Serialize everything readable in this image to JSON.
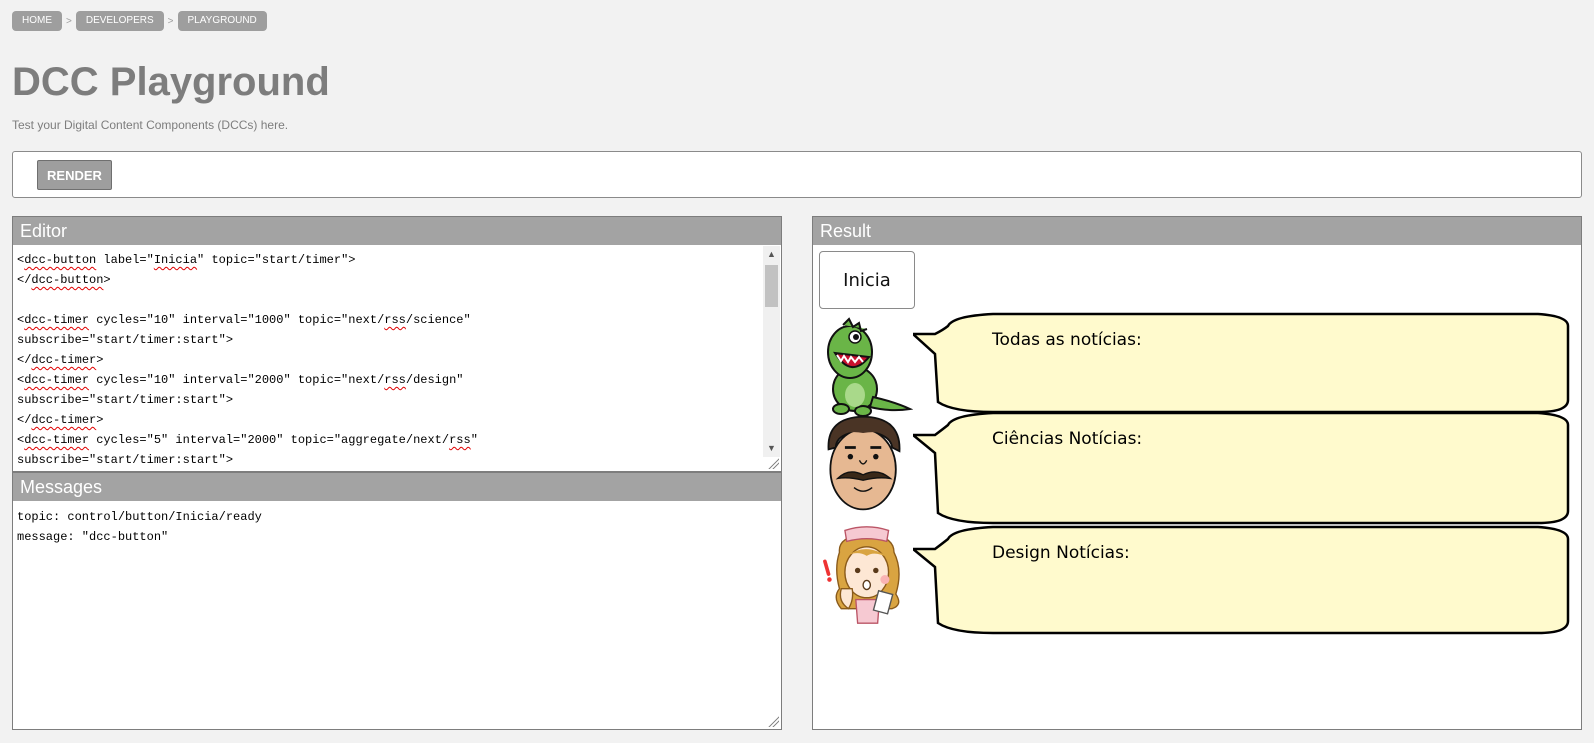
{
  "breadcrumb": [
    "HOME",
    "DEVELOPERS",
    "PLAYGROUND"
  ],
  "breadcrumb_separator": ">",
  "page": {
    "title": "DCC Playground",
    "subtitle": "Test your Digital Content Components (DCCs) here."
  },
  "toolbar": {
    "render_label": "RENDER"
  },
  "editor": {
    "title": "Editor",
    "lines": [
      "<dcc-button label=\"Inicia\" topic=\"start/timer\">",
      "</dcc-button>",
      "",
      "<dcc-timer cycles=\"10\" interval=\"1000\" topic=\"next/rss/science\"",
      "subscribe=\"start/timer:start\">",
      "</dcc-timer>",
      "<dcc-timer cycles=\"10\" interval=\"2000\" topic=\"next/rss/design\"",
      "subscribe=\"start/timer:start\">",
      "</dcc-timer>",
      "<dcc-timer cycles=\"5\" interval=\"2000\" topic=\"aggregate/next/rss\"",
      "subscribe=\"start/timer:start\">"
    ]
  },
  "messages": {
    "title": "Messages",
    "topic_line": "topic: control/button/Inicia/ready",
    "message_line": "message: \"dcc-button\""
  },
  "result": {
    "title": "Result",
    "button_label": "Inicia",
    "bubbles": [
      {
        "character": "dinosaur",
        "text": "Todas as notícias:"
      },
      {
        "character": "mustache-man",
        "text": "Ciências Notícias:"
      },
      {
        "character": "nurse",
        "text": "Design Notícias:"
      }
    ]
  },
  "icons": {
    "scroll_up": "chevron-up-icon",
    "scroll_down": "chevron-down-icon",
    "resize": "resize-grip-icon"
  },
  "colors": {
    "header_bg": "#a3a3a3",
    "crumb_bg": "#9e9e9e",
    "bubble_fill": "#fffacd",
    "title_color": "#7d7d7d"
  }
}
